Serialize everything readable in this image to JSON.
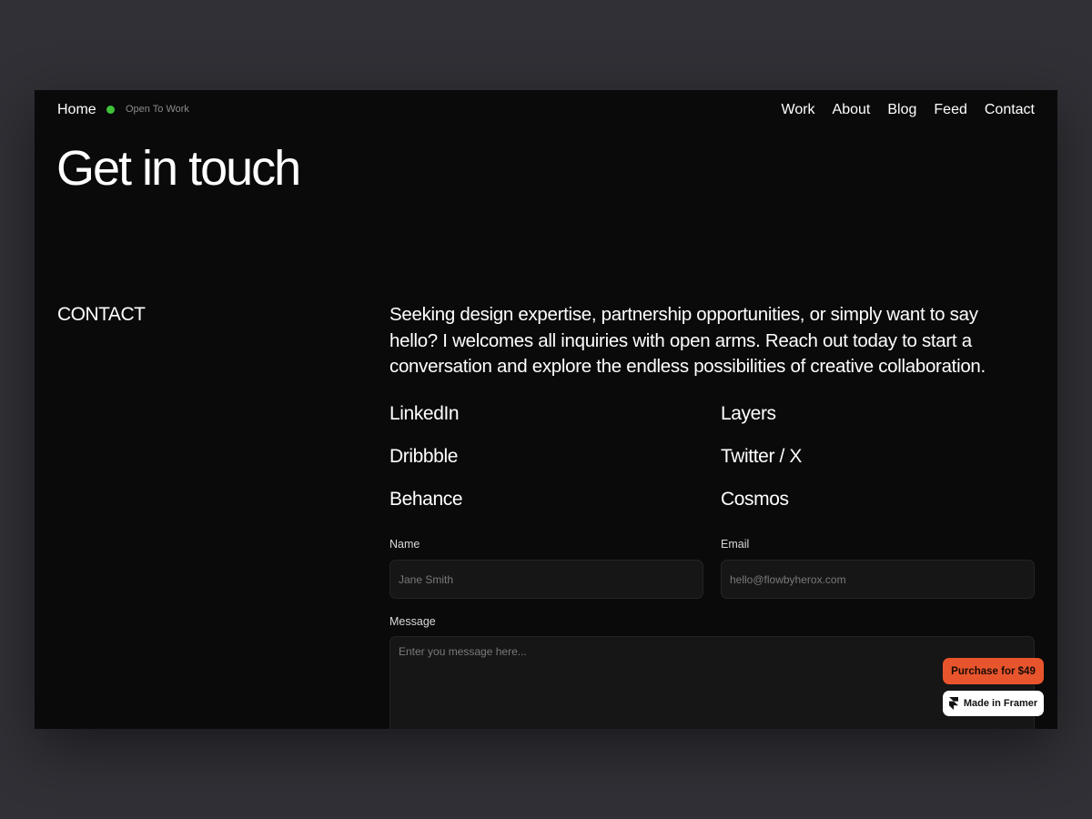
{
  "nav": {
    "home": "Home",
    "status": "Open To Work",
    "status_color": "#3ec23a",
    "links": [
      "Work",
      "About",
      "Blog",
      "Feed",
      "Contact"
    ]
  },
  "hero": {
    "title": "Get in touch"
  },
  "contact": {
    "section_label": "CONTACT",
    "intro": "Seeking design expertise, partnership opportunities, or simply want to say hello? I welcomes all inquiries with open arms. Reach out today to start a conversation and explore the endless possibilities of creative collaboration.",
    "social_links": [
      "LinkedIn",
      "Layers",
      "Dribbble",
      "Twitter / X",
      "Behance",
      "Cosmos"
    ]
  },
  "form": {
    "name_label": "Name",
    "name_placeholder": "Jane Smith",
    "email_label": "Email",
    "email_placeholder": "hello@flowbyherox.com",
    "message_label": "Message",
    "message_placeholder": "Enter you message here..."
  },
  "badges": {
    "purchase": "Purchase for $49",
    "purchase_color": "#e8552d",
    "framer": "Made in Framer",
    "framer_icon": "framer-logo-icon"
  }
}
